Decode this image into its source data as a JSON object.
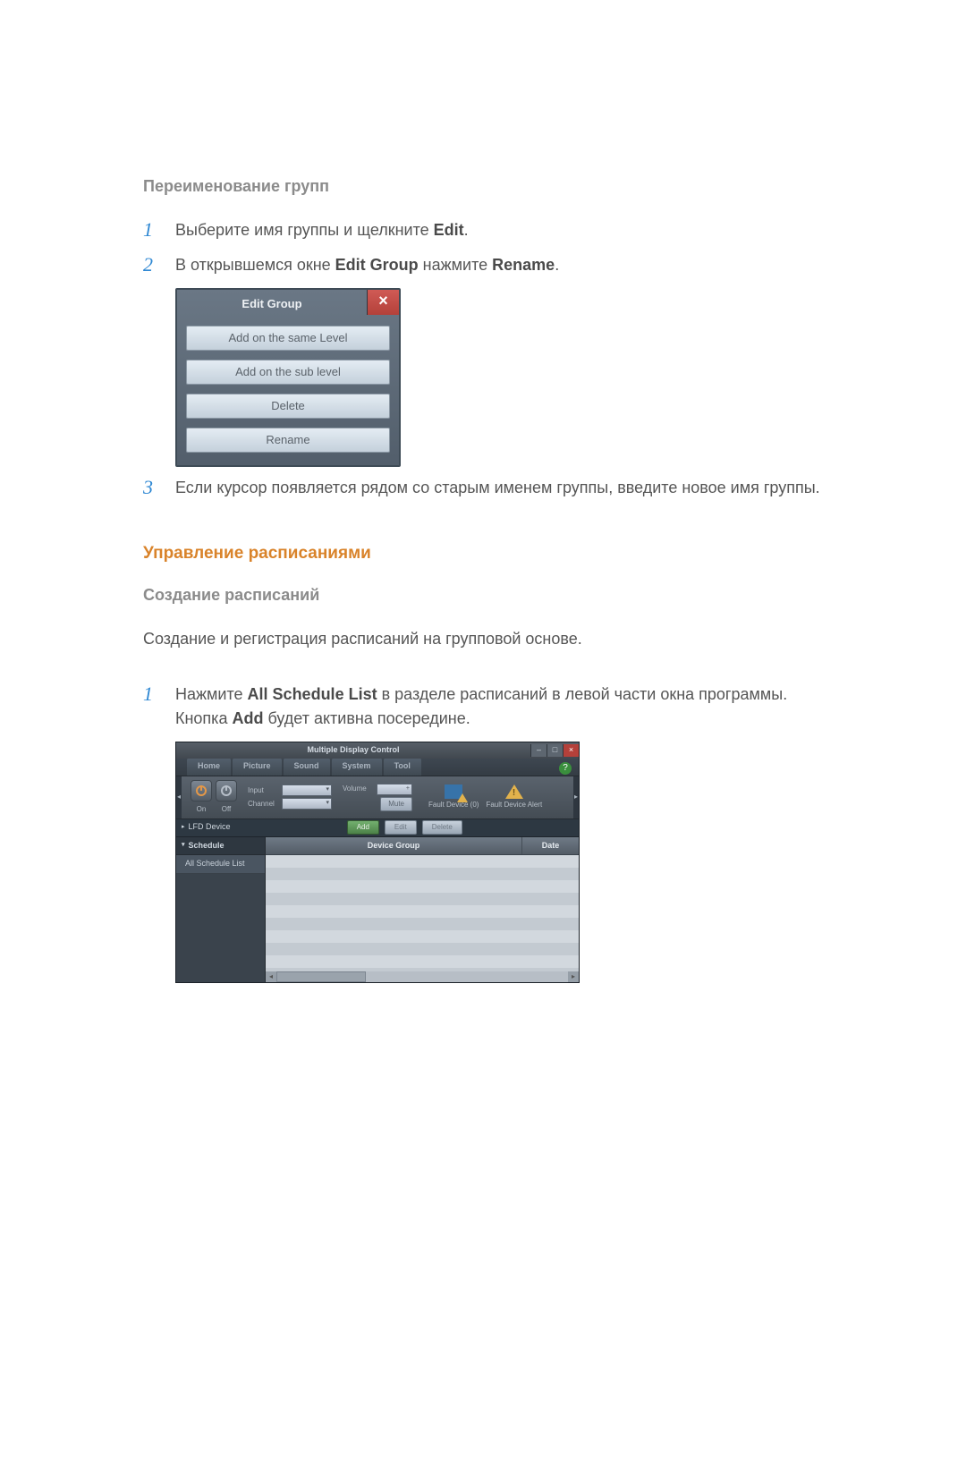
{
  "headings": {
    "rename_groups": "Переименование групп",
    "manage_schedules": "Управление расписаниями",
    "create_schedules": "Создание расписаний"
  },
  "rename": {
    "step1": {
      "pre": "Выберите имя группы и щелкните ",
      "edit": "Edit",
      "post": "."
    },
    "step2": {
      "pre": "В открывшемся окне ",
      "edit_group": "Edit Group",
      "mid": " нажмите ",
      "rename": "Rename",
      "post": "."
    },
    "step3": "Если курсор появляется рядом со старым именем группы, введите новое имя группы."
  },
  "edit_group_dialog": {
    "title": "Edit Group",
    "close": "×",
    "buttons": [
      "Add on the same Level",
      "Add on the sub level",
      "Delete",
      "Rename"
    ]
  },
  "schedule": {
    "intro": "Создание и регистрация расписаний на групповой основе.",
    "step1": {
      "pre": "Нажмите ",
      "all_schedule_list": "All Schedule List",
      "mid": " в разделе расписаний в левой части окна программы. Кнопка ",
      "add": "Add",
      "post": " будет активна посередине."
    }
  },
  "mdc": {
    "title": "Multiple Display Control",
    "winbtns": {
      "min": "–",
      "max": "□",
      "close": "×"
    },
    "help": "?",
    "tabs": [
      "Home",
      "Picture",
      "Sound",
      "System",
      "Tool"
    ],
    "ribbon": {
      "power_on": "On",
      "power_off": "Off",
      "input_label": "Input",
      "channel_label": "Channel",
      "volume_label": "Volume",
      "mute": "Mute",
      "dropdown_caret": "▾",
      "plus": "+",
      "fault1": "Fault Device (0)",
      "fault2": "Fault Device Alert",
      "nav_left": "◂",
      "nav_right": "▸"
    },
    "action_bar": {
      "lfd": "LFD Device",
      "lfd_caret": "▸",
      "add": "Add",
      "edit": "Edit",
      "delete": "Delete"
    },
    "sidebar": {
      "schedule": "Schedule",
      "schedule_caret": "▾",
      "all_schedule_list": "All Schedule List"
    },
    "columns": {
      "group": "Device Group",
      "date": "Date"
    },
    "scroll": {
      "left": "◂",
      "right": "▸"
    }
  }
}
